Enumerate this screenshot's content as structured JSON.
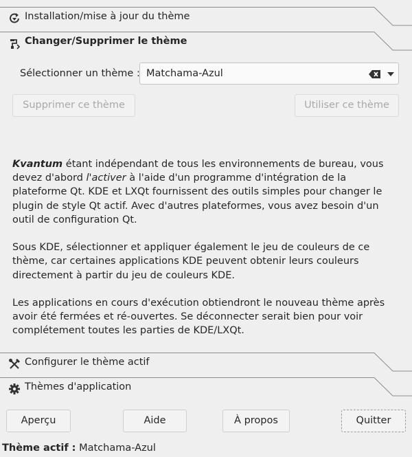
{
  "tabs": {
    "install": {
      "label": "Installation/mise à jour du thème",
      "icon": "refresh-icon"
    },
    "change": {
      "label": "Changer/Supprimer le thème",
      "icon": "brush-icon"
    },
    "configure": {
      "label": "Configurer le thème actif",
      "icon": "tools-icon"
    },
    "apps": {
      "label": "Thèmes d'application",
      "icon": "gear-icon"
    }
  },
  "theme_select": {
    "label": "Sélectionner un thème :",
    "value": "Matchama-Azul"
  },
  "buttons": {
    "delete_theme": "Supprimer ce thème",
    "use_theme": "Utiliser ce thème",
    "preview": "Aperçu",
    "help": "Aide",
    "about": "À propos",
    "quit": "Quitter"
  },
  "description": {
    "p1_brand": "Kvantum",
    "p1_part1": " étant indépendant de tous les environnements de bureau, vous devez d'abord ",
    "p1_em": "l'activer",
    "p1_part2": " à l'aide d'un programme d'intégration de la plateforme Qt. KDE et LXQt fournissent des outils simples pour changer le plugin de style Qt actif. Avec d'autres plateformes, vous avez besoin d'un outil de configuration Qt.",
    "p2": "Sous KDE, sélectionner et appliquer également le jeu de couleurs de ce thème, car certaines applications KDE peuvent obtenir leurs couleurs directement à partir du jeu de couleurs KDE.",
    "p3": "Les applications en cours d'exécution obtiendront le nouveau thème après avoir été fermées et ré-ouvertes. Se déconnecter serait bien pour voir complétement toutes les parties de KDE/LXQt."
  },
  "status": {
    "label": "Thème actif :",
    "value": "Matchama-Azul"
  },
  "colors": {
    "background": "#efefef",
    "text": "#262626",
    "disabled_text": "#a9a9a9",
    "border": "#c4c4c4"
  }
}
